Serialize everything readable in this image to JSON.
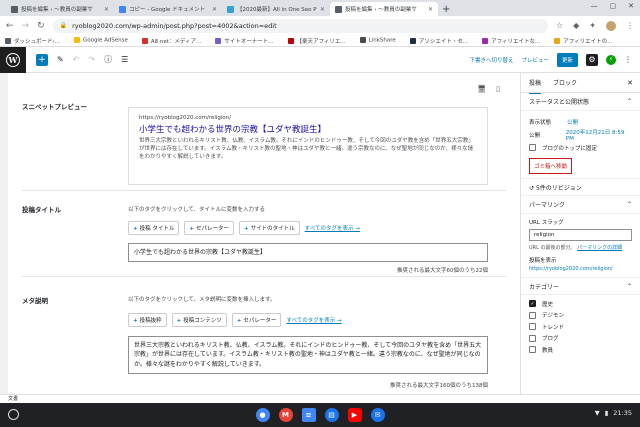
{
  "browser": {
    "tabs": [
      {
        "title": "投稿を編集 ‹ 〜教員の副業サ",
        "color": "#555d66",
        "active": false
      },
      {
        "title": "コピー - Google ドキュメント",
        "color": "#4285f4",
        "active": false
      },
      {
        "title": "【2020最新】All in One Seo P",
        "color": "#39a0d0",
        "active": false
      },
      {
        "title": "投稿を編集 ‹ 〜教員の副業サ",
        "color": "#555d66",
        "active": true
      }
    ],
    "url": "ryoblog2020.com/wp-admin/post.php?post=4002&action=edit",
    "bookmarks": [
      {
        "label": "ダッシュボード‹...",
        "color": "#555d66"
      },
      {
        "label": "Google AdSense",
        "color": "#fbbc04"
      },
      {
        "label": "A8.net：メディア...",
        "color": "#d93025"
      },
      {
        "label": "サイトオーナート...",
        "color": "#7b5cc4"
      },
      {
        "label": "【楽天アフィリエ...",
        "color": "#bf0000"
      },
      {
        "label": "LinkShare",
        "color": "#4a4a4a"
      },
      {
        "label": "アソシエイト・セ...",
        "color": "#232f3e"
      },
      {
        "label": "アフィリエイトな...",
        "color": "#9c27b0"
      },
      {
        "label": "アフィリエイトの...",
        "color": "#e6a817"
      }
    ]
  },
  "toolbar": {
    "draft_switch": "下書きへ切り替え",
    "preview": "プレビュー",
    "update": "更新"
  },
  "seo": {
    "snippet_label": "スニペットプレビュー",
    "snippet_url": "https://ryoblog2020.com/religion/",
    "snippet_title": "小学生でも超わかる世界の宗教【ユダヤ教誕生】",
    "snippet_desc": "世界三大宗教といわれるキリスト教、仏教、イスラム教。それにインドのヒンドゥー教、そして今回のユダヤ教を含め「世界五大宗教」が世界には存在しています。イスラム教・キリスト教の聖地・神はユダヤ教と一緒。違う宗教なのに、なぜ聖地が同じなのか、様々な謎をわかりやすく解説していきます。",
    "title_label": "投稿タイトル",
    "title_hint": "以下のタグをクリックして、タイトルに変数を入力する",
    "title_chips": [
      "投稿 タイトル",
      "セパレーター",
      "サイトのタイトル"
    ],
    "all_tags": "すべてのタグを表示 →",
    "title_value": "小学生でも超わかる世界の宗教【ユダヤ教誕生】",
    "title_count": "推奨される最大文字60個のうち22個",
    "meta_label": "メタ説明",
    "meta_hint": "以下のタグをクリックして、メタ説明に変数を挿入します。",
    "meta_chips": [
      "投稿抜粋",
      "投稿コンテンツ",
      "セパレーター"
    ],
    "meta_value": "世界三大宗教といわれるキリスト教、仏教、イスラム教。それにインドのヒンドゥー教、そして今回のユダヤ教を含め「世界五大宗教」が世界には存在しています。イスラム教・キリスト教の聖地・神はユダヤ教と一緒。違う宗教なのに、なぜ聖地が同じなのか。様々な謎をわかりやすく解説していきます。",
    "meta_count": "推奨される最大文字160個のうち138個"
  },
  "sidebar": {
    "tab_post": "投稿",
    "tab_block": "ブロック",
    "status_heading": "ステータスと公開状態",
    "visibility_label": "表示状態",
    "visibility_value": "公開",
    "publish_label": "公開",
    "publish_value": "2020年12月21日 8:59 PM",
    "sticky_label": "ブログのトップに固定",
    "trash": "ゴミ箱へ移動",
    "revisions": "5件のリビジョン",
    "permalink_heading": "パーマリンク",
    "slug_label": "URL スラッグ",
    "slug_value": "religion",
    "slug_help": "URL の最後の部分。",
    "slug_help_link": "パーマリンクの詳細",
    "view_post_label": "投稿を表示",
    "view_post_link": "https://ryoblog2020.com/religion/",
    "categories_heading": "カテゴリー",
    "categories": [
      {
        "label": "歴史",
        "checked": true
      },
      {
        "label": "デジモン",
        "checked": false
      },
      {
        "label": "トレンド",
        "checked": false
      },
      {
        "label": "ブログ",
        "checked": false
      },
      {
        "label": "教員",
        "checked": false
      }
    ]
  },
  "statusbar": "文書",
  "system": {
    "time": "21:35",
    "shelf_apps": [
      {
        "name": "chrome",
        "color": "#4285f4",
        "glyph": "●"
      },
      {
        "name": "gmail",
        "color": "#ea4335",
        "glyph": "M"
      },
      {
        "name": "docs",
        "color": "#4285f4",
        "glyph": "≡"
      },
      {
        "name": "files",
        "color": "#1a73e8",
        "glyph": "▤"
      },
      {
        "name": "youtube",
        "color": "#ff0000",
        "glyph": "▶"
      },
      {
        "name": "messages",
        "color": "#1a73e8",
        "glyph": "✉"
      }
    ]
  }
}
